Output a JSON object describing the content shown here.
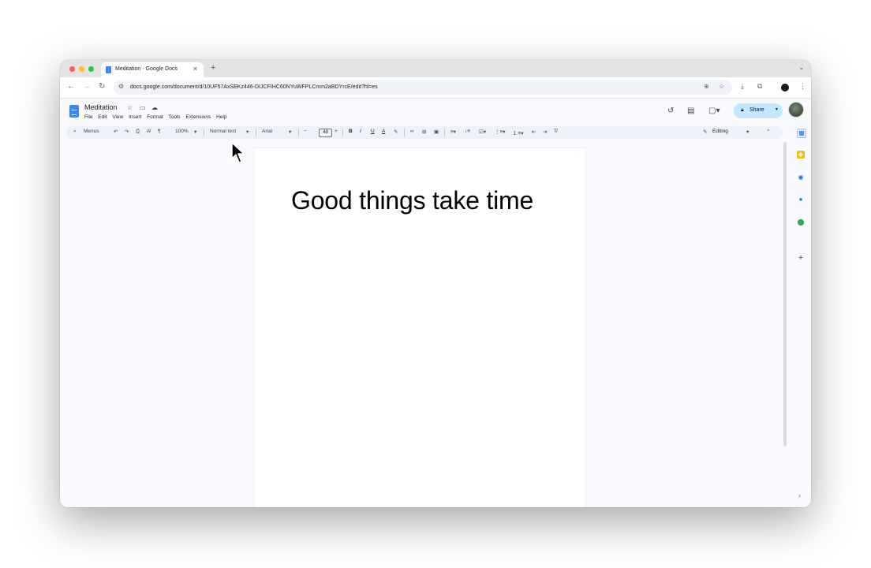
{
  "browser": {
    "tab_title": "Meditation - Google Docs",
    "tab_close": "×",
    "new_tab": "+",
    "url": "docs.google.com/document/d/10UF57AxSEKz446-DIJCFIHC60NYuWFPLCmm2aBDYrcE/edit?hl=es"
  },
  "doc": {
    "title": "Meditation",
    "menu": [
      "File",
      "Edit",
      "View",
      "Insert",
      "Format",
      "Tools",
      "Extensions",
      "Help"
    ],
    "share_label": "Share",
    "body_text": "Good things take time"
  },
  "toolbar": {
    "menus": "Menus",
    "zoom": "100%",
    "style": "Normal text",
    "font": "Arial",
    "font_size": "48",
    "bold": "B",
    "italic": "I",
    "underline": "U",
    "text_color": "A",
    "mode": "Editing"
  },
  "colors": {
    "accent": "#c2e7ff",
    "docs_blue": "#4285f4",
    "toolbar_bg": "#edf2fa"
  }
}
